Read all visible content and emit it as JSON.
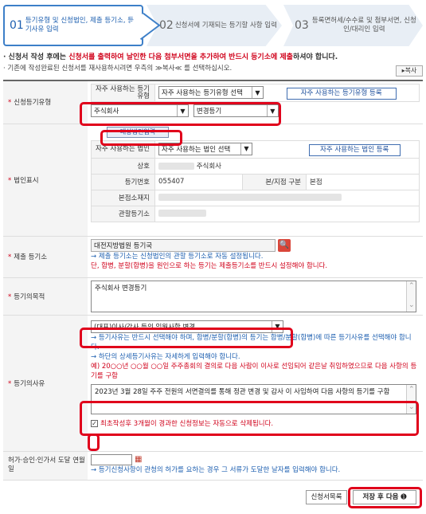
{
  "steps": [
    {
      "num": "01",
      "label": "등기유형 및 신청법인, 제출 등기소, 등기사유 입력"
    },
    {
      "num": "02",
      "label": "신청서에 기재되는 등기할 사항 입력"
    },
    {
      "num": "03",
      "label": "등록면허세/수수료 및 첨부서면, 신청인/대리인 입력"
    }
  ],
  "notice": {
    "line1_pre": "· 신청서 작성 후에는 ",
    "line1_red": "신청서를 출력하여 날인한 다음 첨부서면을 추가하여 반드시 등기소에 제출",
    "line1_post": "하셔야 합니다.",
    "line2": "· 기존에 작성완료된 신청서를 재사용하시려면 우측의 ≫복사≪ 를 선택하십시오.",
    "copy_label": "▸복사"
  },
  "reg_type": {
    "label": "신청등기유형",
    "freq_label": "자주 사용하는 등기유형",
    "freq_select": "자주 사용하는 등기유형 선택",
    "freq_register": "자주 사용하는 등기유형 등록",
    "company_type": "주식회사",
    "reg_kind": "변경등기"
  },
  "corp": {
    "label": "법인표시",
    "input_btn": "대상법인입력",
    "freq_label": "자주 사용하는 법인",
    "freq_select": "자주 사용하는 법인 선택",
    "freq_register": "자주 사용하는 법인 등록",
    "name_label": "상호",
    "name_value": "주식회사",
    "regno_label": "등기번호",
    "regno_value": "055407",
    "branch_label": "본/지점 구분",
    "branch_value": "본점",
    "addr_label": "본점소재지",
    "office_label": "관할등기소"
  },
  "submit_office": {
    "label": "제출 등기소",
    "value": "대전지방법원 등기국",
    "note1": "→ 제출 등기소는 신청법인의 관할 등기소로 자동 설정됩니다.",
    "note2": "단, 합병, 분할(합병)을 원인으로 하는 등기는 제출등기소를 반드시 설정해야 합니다."
  },
  "purpose": {
    "label": "등기의목적",
    "value": "주식회사 변경등기"
  },
  "reason": {
    "label": "등기의사유",
    "select_value": "(대표)이사/감사 등의 임원사항 변경",
    "note1": "→ 등기사유는 반드시 선택해야 하며, 합병/분할(합병)의 등기는 합병/분할(합병)에 따른 등기사유를 선택해야 합니다.",
    "note2": "→ 하단의 상세등기사유는 자세하게 입력해야 합니다.",
    "example": "예) 20○○년 ○○월 ○○일 주주총회의 결의로 다음 사람이 이사로 선임되어 같은날 취임하였으므로 다음 사항의 등기를 구함",
    "detail": "2023년 3월 28일 주주 전원의 서면결의를 통해 정관 변경 및 감사        이 사임하여 다음 사항의 등기를 구함",
    "delete_note": "최초작성후 3개월이 경과한 신청정보는 자동으로 삭제됩니다."
  },
  "permit": {
    "label": "허가·승인·인가서 도달 연월일",
    "note": "→ 등기신청사항이 관청의 허가를 요하는 경우 그 서류가 도달한 날자를 입력해야 합니다."
  },
  "footer": {
    "list_btn": "신청서목록",
    "next_btn": "저장 후 다음 ➊"
  },
  "colors": {
    "accent": "#1d5fb0",
    "warning": "#d0021b",
    "highlight": "#e0001b"
  }
}
